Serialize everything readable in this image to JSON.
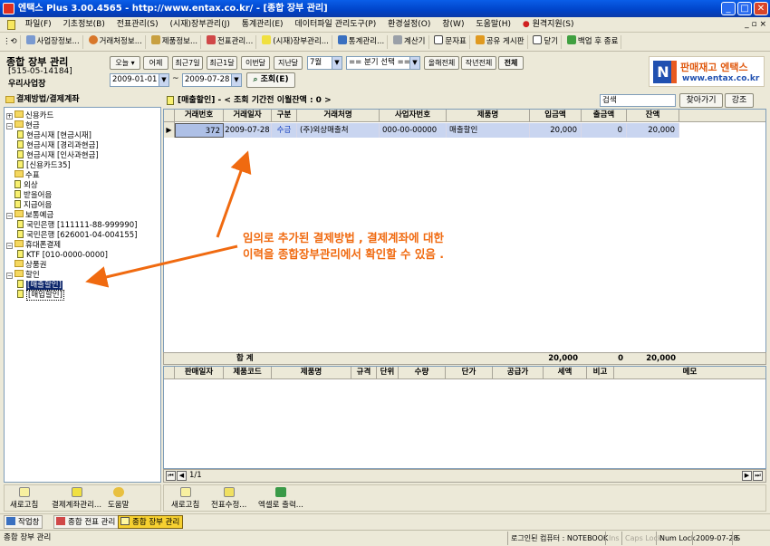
{
  "window": {
    "title": "엔택스 Plus 3.00.4565 - http://www.entax.co.kr/ - [종합 장부 관리]"
  },
  "menu": [
    "파일(F)",
    "기초정보(B)",
    "전표관리(S)",
    "(시재)장부관리(J)",
    "통계관리(E)",
    "데이터파일 관리도구(P)",
    "환경설정(O)",
    "창(W)",
    "도움말(H)",
    "원격지원(S)"
  ],
  "quickbar": [
    "사업장정보...",
    "거래처정보...",
    "제품정보...",
    "전표관리...",
    "(시재)장부관리...",
    "통계관리...",
    "계산기",
    "문자표",
    "공유 게시판",
    "닫기",
    "백업 후 종료"
  ],
  "page": {
    "title": "종합 장부 관리",
    "biz_no": "[515-05-14184]",
    "biz_name": "우리사업장"
  },
  "filter": {
    "period_buttons": [
      "오늘",
      "어제",
      "최근7일",
      "최근1달",
      "이번달",
      "지난달"
    ],
    "month": "7월",
    "quarter": "== 분기 선택 ==",
    "year_buttons": [
      "올해전체",
      "작년전체",
      "전체"
    ],
    "date_from": "2009-01-01",
    "date_sep": "~",
    "date_to": "2009-07-28",
    "query_btn": "조회(E)"
  },
  "logo": {
    "name": "판매재고 엔택스",
    "url": "www.entax.co.kr",
    "mark": "N"
  },
  "left": {
    "header": "결제방법/결제계좌",
    "tree": [
      {
        "label": "신용카드",
        "level": 0,
        "type": "folder",
        "exp": "+"
      },
      {
        "label": "현금",
        "level": 0,
        "type": "folder",
        "exp": "−"
      },
      {
        "label": "현금시재 [현금시재]",
        "level": 1,
        "type": "doc"
      },
      {
        "label": "현금시재 [경리과현금]",
        "level": 1,
        "type": "doc"
      },
      {
        "label": "현금시재 [인사과현금]",
        "level": 1,
        "type": "doc"
      },
      {
        "label": "[신용카드35]",
        "level": 1,
        "type": "doc"
      },
      {
        "label": "수표",
        "level": 0,
        "type": "folder"
      },
      {
        "label": "외상",
        "level": 0,
        "type": "doc"
      },
      {
        "label": "받을어음",
        "level": 0,
        "type": "doc"
      },
      {
        "label": "지급어음",
        "level": 0,
        "type": "doc"
      },
      {
        "label": "보통예금",
        "level": 0,
        "type": "folder",
        "exp": "−"
      },
      {
        "label": "국민은행 [111111-88-999990]",
        "level": 1,
        "type": "doc"
      },
      {
        "label": "국민은행 [626001-04-004155]",
        "level": 1,
        "type": "doc"
      },
      {
        "label": "휴대폰결제",
        "level": 0,
        "type": "folder",
        "exp": "−"
      },
      {
        "label": "KTF [010-0000-0000]",
        "level": 1,
        "type": "doc"
      },
      {
        "label": "상품권",
        "level": 0,
        "type": "folder"
      },
      {
        "label": "할인",
        "level": 0,
        "type": "folder",
        "exp": "−"
      },
      {
        "label": "[매출할인]",
        "level": 1,
        "type": "doc",
        "selected": true
      },
      {
        "label": "[매입할인]",
        "level": 1,
        "type": "doc"
      }
    ]
  },
  "grid_header": {
    "title": "[매출할인]  -  < 조회 기간전 이월잔액 : 0 >",
    "search_label": "검색",
    "find_btn": "찾아가기",
    "highlight_btn": "강조"
  },
  "grid": {
    "columns": [
      "거래번호",
      "거래일자",
      "구분",
      "거래처명",
      "사업자번호",
      "제품명",
      "입금액",
      "출금액",
      "잔액"
    ],
    "rows": [
      [
        "372",
        "2009-07-28",
        "수금",
        "(주)외상매출처",
        "000-00-00000",
        "매출할인",
        "20,000",
        "0",
        "20,000"
      ]
    ],
    "total_label": "합 계",
    "totals": {
      "in": "20,000",
      "out": "0",
      "balance": "20,000"
    }
  },
  "detail": {
    "columns": [
      "판매일자",
      "제품코드",
      "제품명",
      "규격",
      "단위",
      "수량",
      "단가",
      "공급가",
      "세액",
      "비고",
      "메모"
    ]
  },
  "nav": {
    "page": "1/1"
  },
  "left_tools": [
    "새로고침",
    "결제계좌관리...",
    "도움말"
  ],
  "right_tools": [
    "새로고침",
    "전표수정...",
    "엑셀로 출력..."
  ],
  "tasks": [
    "작업창",
    "종합 전표 관리",
    "종합 장부 관리"
  ],
  "status": {
    "left": "종합 장부 관리",
    "pc": "로그인된 컴퓨터 : NOTEBOOK",
    "ins": "Ins",
    "caps": "Caps Lock",
    "num": "Num Lock",
    "date": "2009-07-28",
    "s": "S"
  },
  "annotation": {
    "line1": "임의로 추가된 결제방법 , 결제계좌에 대한",
    "line2": "이력을 종합장부관리에서 확인할 수 있음 ."
  },
  "colors": {
    "accent": "#f06a10",
    "titlebar": "#0a5ee8",
    "selected_row": "#c9d5f0"
  }
}
